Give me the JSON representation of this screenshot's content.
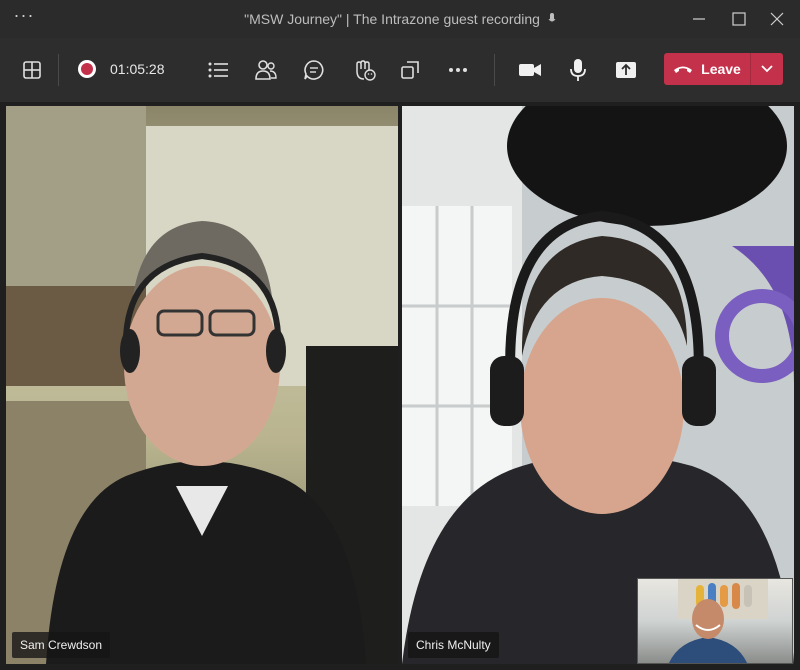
{
  "window": {
    "title": "\"MSW Journey\" | The Intrazone guest recording"
  },
  "toolbar": {
    "timer": "01:05:28",
    "leave_label": "Leave"
  },
  "participants": [
    {
      "name": "Sam Crewdson"
    },
    {
      "name": "Chris McNulty"
    }
  ],
  "colors": {
    "leave_red": "#c4314b",
    "toolbar_bg": "#2d2d2d",
    "titlebar_bg": "#2b2b2b"
  },
  "icons": {
    "toolbar": [
      "gallery-layout-icon",
      "record-icon",
      "meeting-chat-list-icon",
      "participants-icon",
      "chat-icon",
      "reactions-icon",
      "apps-icon",
      "more-icon",
      "camera-icon",
      "mic-icon",
      "share-icon",
      "hang-up-icon",
      "chevron-down-icon"
    ]
  }
}
